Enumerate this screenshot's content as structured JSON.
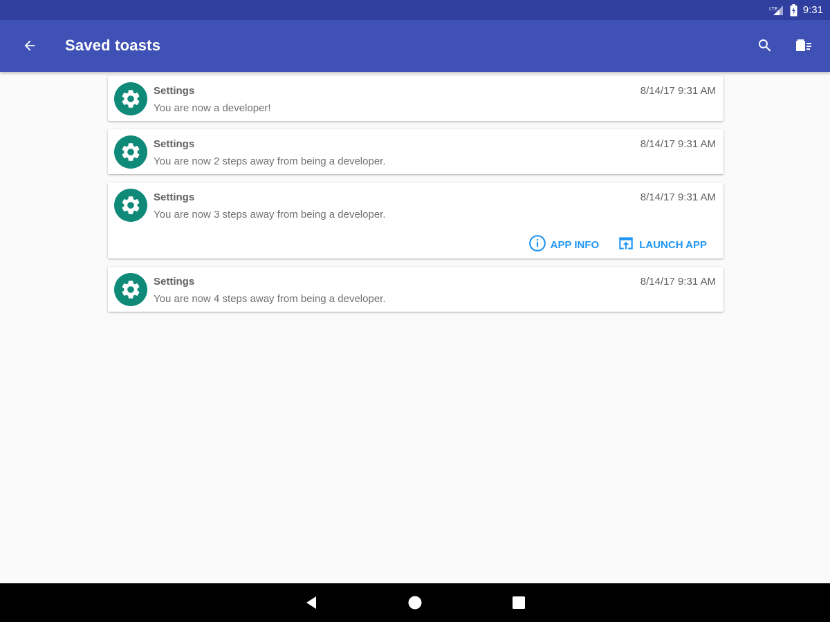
{
  "status_bar": {
    "network": "LTE",
    "time": "9:31",
    "icons": [
      "signal-icon",
      "battery-icon"
    ]
  },
  "app_bar": {
    "title": "Saved toasts",
    "icons": [
      "back-arrow-icon",
      "search-icon",
      "clear-all-icon"
    ]
  },
  "toasts": [
    {
      "app": "Settings",
      "time": "8/14/17 9:31 AM",
      "message": "You are now a developer!",
      "icon": "settings-gear-icon"
    },
    {
      "app": "Settings",
      "time": "8/14/17 9:31 AM",
      "message": "You are now 2 steps away from being a developer.",
      "icon": "settings-gear-icon"
    },
    {
      "app": "Settings",
      "time": "8/14/17 9:31 AM",
      "message": "You are now 3 steps away from being a developer.",
      "icon": "settings-gear-icon",
      "actions": {
        "app_info": "APP INFO",
        "launch_app": "LAUNCH APP"
      }
    },
    {
      "app": "Settings",
      "time": "8/14/17 9:31 AM",
      "message": "You are now 4 steps away from being a developer.",
      "icon": "settings-gear-icon"
    }
  ],
  "nav_bar": {
    "buttons": [
      "back-triangle-icon",
      "home-circle-icon",
      "recents-square-icon"
    ]
  },
  "colors": {
    "status_bar": "#303f9f",
    "app_bar": "#3f51b5",
    "avatar": "#0f8a78",
    "accent": "#2196f3"
  }
}
